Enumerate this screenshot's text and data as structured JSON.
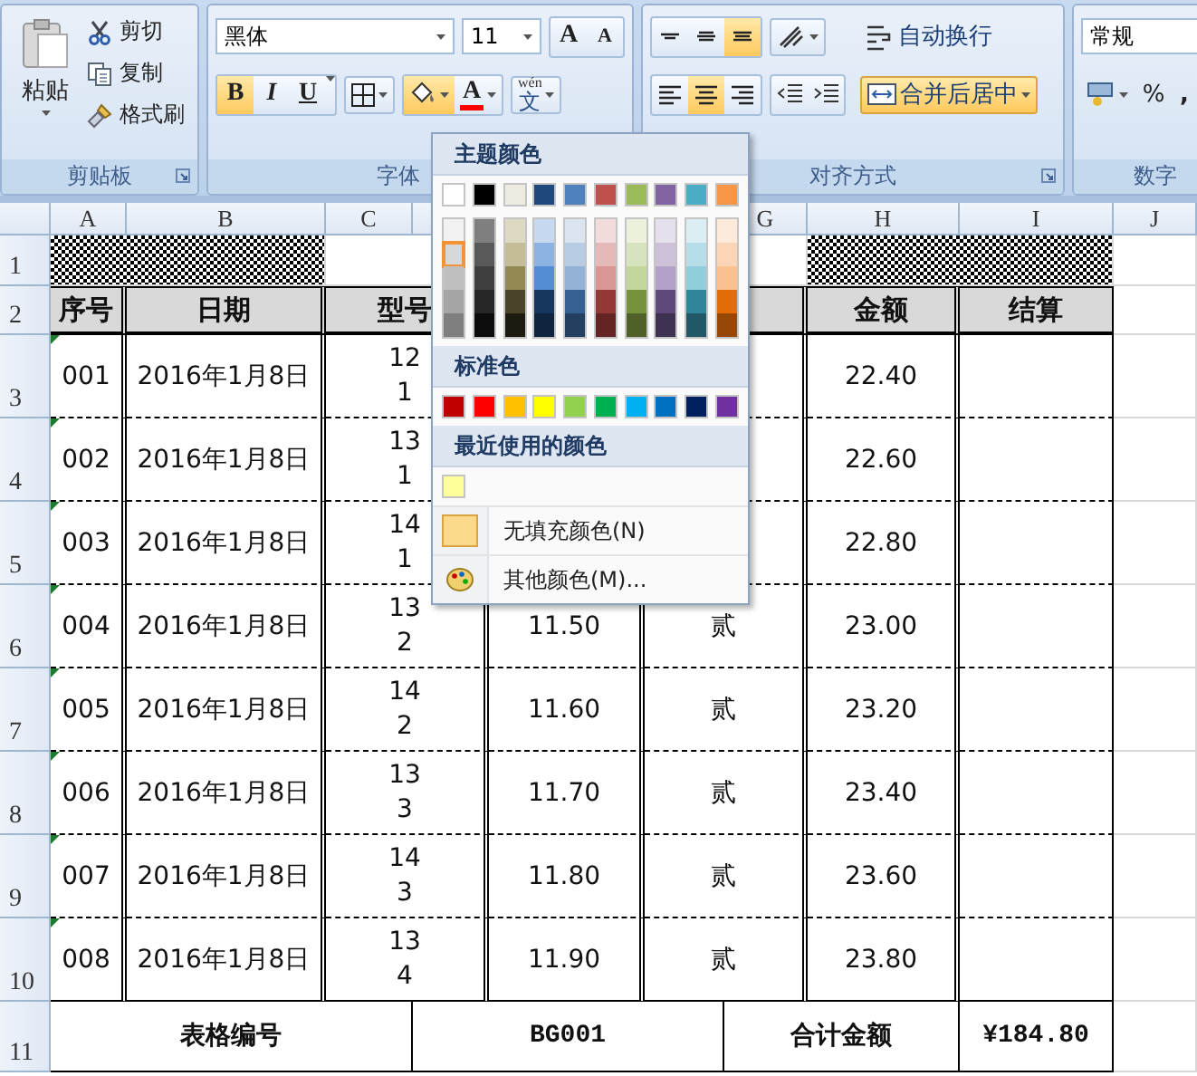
{
  "clipboard": {
    "paste": "粘贴",
    "items": [
      {
        "kind": "cut",
        "label": "剪切"
      },
      {
        "kind": "copy",
        "label": "复制"
      },
      {
        "kind": "painter",
        "label": "格式刷"
      }
    ],
    "title": "剪贴板"
  },
  "font": {
    "family": "黑体",
    "size": "11",
    "grow": "A",
    "shrink": "A",
    "styles": [
      {
        "kind": "bold",
        "label": "B",
        "selected": true
      },
      {
        "kind": "italic",
        "label": "I",
        "selected": false
      },
      {
        "kind": "underline",
        "label": "U",
        "selected": false
      }
    ],
    "fill_selected": true,
    "font_color": {
      "label": "A",
      "color": "#ff0000"
    },
    "phonetic": {
      "top": "wén",
      "main": "文"
    },
    "title": "字体"
  },
  "alignment": {
    "vertical": [
      {
        "kind": "top",
        "selected": false
      },
      {
        "kind": "middle",
        "selected": false
      },
      {
        "kind": "bottom",
        "selected": true
      }
    ],
    "wrap": "自动换行",
    "horizontal": [
      {
        "kind": "left",
        "selected": false
      },
      {
        "kind": "center",
        "selected": true
      },
      {
        "kind": "right",
        "selected": false
      }
    ],
    "merge": {
      "label": "合并后居中",
      "selected": true
    },
    "title": "对齐方式"
  },
  "number": {
    "format": "常规",
    "percent": "%",
    "comma": ",",
    "title": "数字"
  },
  "popup": {
    "theme_title": "主题颜色",
    "theme": [
      {
        "color": "#ffffff",
        "selected": false,
        "shades": [
          {
            "color": "#f2f2f2",
            "selected": false
          },
          {
            "color": "#d8d8d8",
            "selected": true
          },
          {
            "color": "#bfbfbf",
            "selected": false
          },
          {
            "color": "#a5a5a5",
            "selected": false
          },
          {
            "color": "#7f7f7f",
            "selected": false
          }
        ]
      },
      {
        "color": "#000000",
        "selected": false,
        "shades": [
          {
            "color": "#7f7f7f",
            "selected": false
          },
          {
            "color": "#595959",
            "selected": false
          },
          {
            "color": "#3f3f3f",
            "selected": false
          },
          {
            "color": "#262626",
            "selected": false
          },
          {
            "color": "#0c0c0c",
            "selected": false
          }
        ]
      },
      {
        "color": "#eeece1",
        "selected": false,
        "shades": [
          {
            "color": "#ddd9c3",
            "selected": false
          },
          {
            "color": "#c4bd97",
            "selected": false
          },
          {
            "color": "#938953",
            "selected": false
          },
          {
            "color": "#494429",
            "selected": false
          },
          {
            "color": "#1d1b10",
            "selected": false
          }
        ]
      },
      {
        "color": "#1f497d",
        "selected": false,
        "shades": [
          {
            "color": "#c6d9f0",
            "selected": false
          },
          {
            "color": "#8db3e2",
            "selected": false
          },
          {
            "color": "#548dd4",
            "selected": false
          },
          {
            "color": "#17365d",
            "selected": false
          },
          {
            "color": "#0f243e",
            "selected": false
          }
        ]
      },
      {
        "color": "#4f81bd",
        "selected": false,
        "shades": [
          {
            "color": "#dbe5f1",
            "selected": false
          },
          {
            "color": "#b8cce4",
            "selected": false
          },
          {
            "color": "#95b3d7",
            "selected": false
          },
          {
            "color": "#366092",
            "selected": false
          },
          {
            "color": "#244061",
            "selected": false
          }
        ]
      },
      {
        "color": "#c0504d",
        "selected": false,
        "shades": [
          {
            "color": "#f2dcdb",
            "selected": false
          },
          {
            "color": "#e5b9b7",
            "selected": false
          },
          {
            "color": "#d99694",
            "selected": false
          },
          {
            "color": "#953734",
            "selected": false
          },
          {
            "color": "#632423",
            "selected": false
          }
        ]
      },
      {
        "color": "#9bbb59",
        "selected": false,
        "shades": [
          {
            "color": "#ebf1dd",
            "selected": false
          },
          {
            "color": "#d7e3bc",
            "selected": false
          },
          {
            "color": "#c3d69b",
            "selected": false
          },
          {
            "color": "#76923c",
            "selected": false
          },
          {
            "color": "#4f6128",
            "selected": false
          }
        ]
      },
      {
        "color": "#8064a2",
        "selected": false,
        "shades": [
          {
            "color": "#e5e0ec",
            "selected": false
          },
          {
            "color": "#ccc1d9",
            "selected": false
          },
          {
            "color": "#b2a2c7",
            "selected": false
          },
          {
            "color": "#5f497a",
            "selected": false
          },
          {
            "color": "#3f3151",
            "selected": false
          }
        ]
      },
      {
        "color": "#4bacc6",
        "selected": false,
        "shades": [
          {
            "color": "#dbeef3",
            "selected": false
          },
          {
            "color": "#b7dde8",
            "selected": false
          },
          {
            "color": "#92cddc",
            "selected": false
          },
          {
            "color": "#31859b",
            "selected": false
          },
          {
            "color": "#205867",
            "selected": false
          }
        ]
      },
      {
        "color": "#f79646",
        "selected": false,
        "shades": [
          {
            "color": "#fdeada",
            "selected": false
          },
          {
            "color": "#fbd5b5",
            "selected": false
          },
          {
            "color": "#fac08f",
            "selected": false
          },
          {
            "color": "#e36c09",
            "selected": false
          },
          {
            "color": "#974806",
            "selected": false
          }
        ]
      }
    ],
    "standard_title": "标准色",
    "standard": [
      {
        "color": "#c00000"
      },
      {
        "color": "#ff0000"
      },
      {
        "color": "#ffc000"
      },
      {
        "color": "#ffff00"
      },
      {
        "color": "#92d050"
      },
      {
        "color": "#00b050"
      },
      {
        "color": "#00b0f0"
      },
      {
        "color": "#0070c0"
      },
      {
        "color": "#002060"
      },
      {
        "color": "#7030a0"
      }
    ],
    "recent_title": "最近使用的颜色",
    "recent": [
      {
        "color": "#ffff99"
      }
    ],
    "items": [
      {
        "kind": "no-fill",
        "label": "无填充颜色(N)"
      },
      {
        "kind": "more",
        "label": "其他颜色(M)..."
      }
    ]
  },
  "sheet": {
    "columns": [
      "A",
      "B",
      "C",
      "G",
      "H",
      "I",
      "J"
    ],
    "rows": [
      "1",
      "2",
      "3",
      "4",
      "5",
      "6",
      "7",
      "8",
      "9",
      "10",
      "11"
    ],
    "title_row": [
      {
        "kind": "pattern"
      },
      {
        "kind": "blank"
      },
      {
        "kind": "pattern"
      }
    ],
    "headers": [
      "序号",
      "日期",
      "型号",
      "金额",
      "结算"
    ],
    "data": [
      {
        "no": "001",
        "date": "2016年1月8日",
        "model": "12\n1",
        "amount": "22.40",
        "flagged": true
      },
      {
        "no": "002",
        "date": "2016年1月8日",
        "model": "13\n1",
        "amount": "22.60",
        "flagged": true
      },
      {
        "no": "003",
        "date": "2016年1月8日",
        "model": "14\n1",
        "amount": "22.80",
        "flagged": true
      },
      {
        "no": "004",
        "date": "2016年1月8日",
        "model": "13\n2",
        "price": "11.50",
        "qty": "贰",
        "amount": "23.00",
        "flagged": true
      },
      {
        "no": "005",
        "date": "2016年1月8日",
        "model": "14\n2",
        "price": "11.60",
        "qty": "贰",
        "amount": "23.20",
        "flagged": true
      },
      {
        "no": "006",
        "date": "2016年1月8日",
        "model": "13\n3",
        "price": "11.70",
        "qty": "贰",
        "amount": "23.40",
        "flagged": true
      },
      {
        "no": "007",
        "date": "2016年1月8日",
        "model": "14\n3",
        "price": "11.80",
        "qty": "贰",
        "amount": "23.60",
        "flagged": true
      },
      {
        "no": "008",
        "date": "2016年1月8日",
        "model": "13\n4",
        "price": "11.90",
        "qty": "贰",
        "amount": "23.80",
        "flagged": true
      }
    ],
    "footer": {
      "label": "表格编号",
      "code": "BG001",
      "total_label": "合计金额",
      "total": "¥184.80"
    }
  }
}
